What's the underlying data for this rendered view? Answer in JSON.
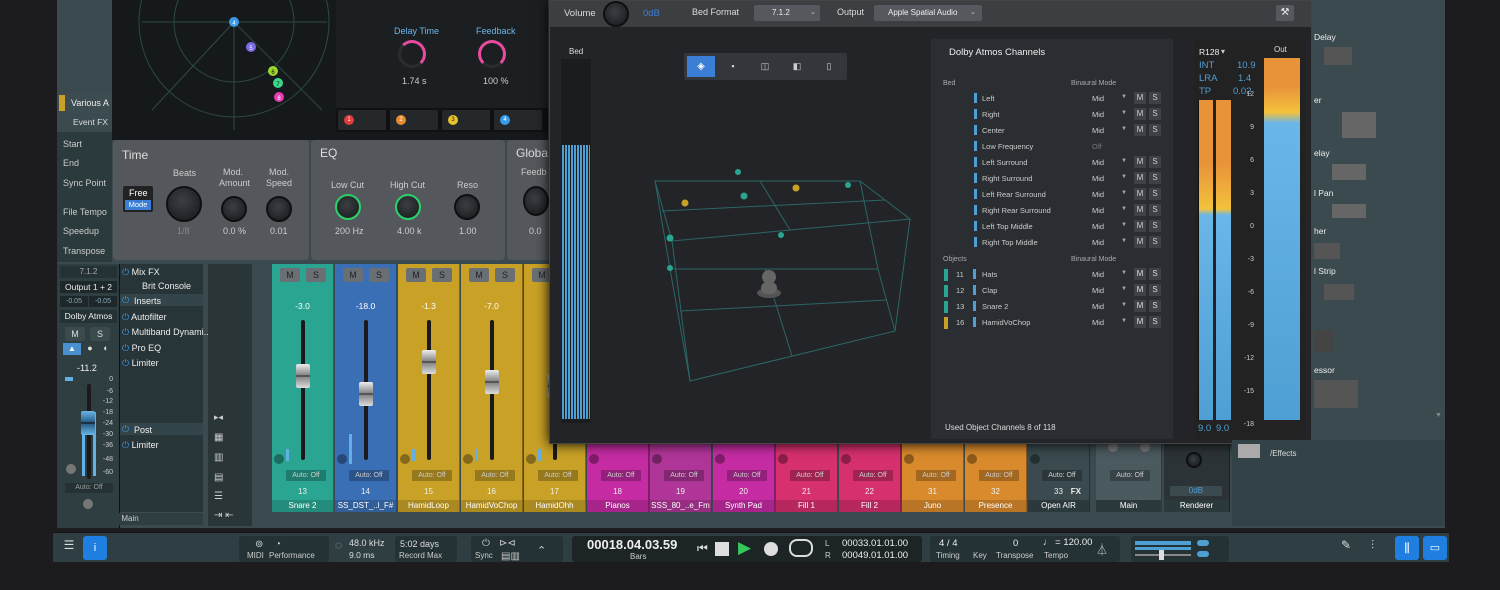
{
  "sequence": {
    "track_name": "Various A",
    "event_fx": "Event FX",
    "rows": [
      "Start",
      "End",
      "Sync Point",
      "File Tempo",
      "Speedup",
      "Transpose"
    ]
  },
  "fx": {
    "delay_time_label": "Delay Time",
    "delay_time_value": "1.74 s",
    "feedback_label": "Feedback",
    "feedback_value": "100 %",
    "slots": [
      "1",
      "2",
      "3",
      "4"
    ],
    "slot_colors": [
      "#e23b3b",
      "#e88a2e",
      "#e8c22e",
      "#3a9be8"
    ],
    "dots": [
      "4",
      "5",
      "6",
      "7",
      "8"
    ],
    "time_panel": {
      "title": "Time",
      "free": "Free",
      "mode": "Mode",
      "beats": "Beats",
      "beats_val": "1/8",
      "mod_amount": "Mod. Amount",
      "mod_amount_val": "0.0 %",
      "mod_speed": "Mod. Speed",
      "mod_speed_val": "0.01"
    },
    "eq_panel": {
      "title": "EQ",
      "low_cut": "Low Cut",
      "low_cut_val": "200 Hz",
      "high_cut": "High Cut",
      "high_cut_val": "4.00 k",
      "reso": "Reso",
      "reso_val": "1.00"
    },
    "global_panel": {
      "title": "Globa",
      "feedback": "Feedb",
      "feedback_val": "0.0"
    }
  },
  "main_channel": {
    "format": "7.1.2",
    "output": "Output 1 + 2",
    "pan_l": "-0.05",
    "pan_r": "-0.05",
    "dolby": "Dolby Atmos",
    "m": "M",
    "s": "S",
    "level": "-11.2",
    "auto": "Auto: Off",
    "name": "Main",
    "scale": [
      "0",
      "-6",
      "-12",
      "-18",
      "-24",
      "-30",
      "-36",
      "-48",
      "-60"
    ]
  },
  "inserts": {
    "mix_fx": "Mix FX",
    "console": "Brit Console",
    "inserts_label": "Inserts",
    "items": [
      "Autofilter",
      "Multiband Dynami...",
      "Pro EQ",
      "Limiter"
    ],
    "post_label": "Post",
    "post_items": [
      "Limiter"
    ]
  },
  "strips": [
    {
      "num": "13",
      "name": "Snare 2",
      "level": "-3.0",
      "color": "#2aa592",
      "auto": "Auto: Off"
    },
    {
      "num": "14",
      "name": "SS_DST_..l_F#",
      "level": "-18.0",
      "color": "#3b6fb5",
      "auto": "Auto: Off"
    },
    {
      "num": "15",
      "name": "HamidLoop",
      "level": "-1.3",
      "color": "#c9a127",
      "auto": "Auto: Off"
    },
    {
      "num": "16",
      "name": "HamidVoChop",
      "level": "-7.0",
      "color": "#c9a127",
      "auto": "Auto: Off"
    },
    {
      "num": "17",
      "name": "HamidOhh",
      "level": "",
      "color": "#c9a127",
      "auto": "Auto: Off"
    },
    {
      "num": "18",
      "name": "Pianos",
      "level": "",
      "color": "#c52ca4",
      "auto": "Auto: Off"
    },
    {
      "num": "19",
      "name": "SSS_80_..e_Fm",
      "level": "",
      "color": "#b03598",
      "auto": "Auto: Off"
    },
    {
      "num": "20",
      "name": "Synth Pad",
      "level": "",
      "color": "#c52ca4",
      "auto": "Auto: Off"
    },
    {
      "num": "21",
      "name": "Fill 1",
      "level": "",
      "color": "#d6306e",
      "auto": "Auto: Off"
    },
    {
      "num": "22",
      "name": "Fill 2",
      "level": "",
      "color": "#d6306e",
      "auto": "Auto: Off"
    },
    {
      "num": "31",
      "name": "Juno",
      "level": "",
      "color": "#d98a2c",
      "auto": "Auto: Off"
    },
    {
      "num": "32",
      "name": "Presence",
      "level": "",
      "color": "#d98a2c",
      "auto": "Auto: Off"
    },
    {
      "num": "33",
      "name": "Open AIR",
      "level": "",
      "color": "#3a4a4e",
      "auto": "Auto: Off",
      "fx": "FX"
    },
    {
      "num": "",
      "name": "Main",
      "level": "",
      "color": "#4a5a5e",
      "auto": "Auto: Off"
    },
    {
      "num": "",
      "name": "Renderer",
      "level": "0dB",
      "color": "#2c3336",
      "auto": ""
    }
  ],
  "strip_ms": {
    "m": "M",
    "s": "S"
  },
  "dolby": {
    "volume_label": "Volume",
    "volume_value": "0dB",
    "bed_format_label": "Bed Format",
    "bed_format_value": "7.1.2",
    "output_label": "Output",
    "output_value": "Apple Spatial Audio",
    "bed_label": "Bed",
    "channels_title": "Dolby Atmos Channels",
    "bed_section": "Bed",
    "binaural_mode": "Binaural Mode",
    "objects_section": "Objects",
    "bed_channels": [
      {
        "name": "Left",
        "mode": "Mid"
      },
      {
        "name": "Right",
        "mode": "Mid"
      },
      {
        "name": "Center",
        "mode": "Mid"
      },
      {
        "name": "Low Frequency",
        "mode": "Off"
      },
      {
        "name": "Left Surround",
        "mode": "Mid"
      },
      {
        "name": "Right Surround",
        "mode": "Mid"
      },
      {
        "name": "Left Rear Surround",
        "mode": "Mid"
      },
      {
        "name": "Right Rear Surround",
        "mode": "Mid"
      },
      {
        "name": "Left Top Middle",
        "mode": "Mid"
      },
      {
        "name": "Right Top Middle",
        "mode": "Mid"
      }
    ],
    "objects": [
      {
        "num": "11",
        "name": "Hats",
        "mode": "Mid",
        "color": "#2aa592"
      },
      {
        "num": "12",
        "name": "Clap",
        "mode": "Mid",
        "color": "#2aa592"
      },
      {
        "num": "13",
        "name": "Snare 2",
        "mode": "Mid",
        "color": "#2aa592"
      },
      {
        "num": "16",
        "name": "HamidVoChop",
        "mode": "Mid",
        "color": "#c9a127"
      }
    ],
    "used_objects": "Used Object Channels  8 of 118",
    "loudness": {
      "standard": "R128",
      "int_label": "INT",
      "int": "10.9",
      "lra_label": "LRA",
      "lra": "1.4",
      "tp_label": "TP",
      "tp": "0.02",
      "left": "9.0",
      "right": "9.0"
    },
    "out_label": "Out",
    "scale": [
      "12",
      "9",
      "6",
      "3",
      "0",
      "-3",
      "-6",
      "-9",
      "-12",
      "-15",
      "-18"
    ]
  },
  "browser": {
    "items": [
      "Delay",
      "er",
      "elay",
      "l Pan",
      "her",
      "l Strip",
      "essor"
    ],
    "effects": "/Effects"
  },
  "transport": {
    "midi": "MIDI",
    "performance": "Performance",
    "sample_rate": "48.0 kHz",
    "latency": "9.0 ms",
    "record_max_days": "5:02 days",
    "record_max": "Record Max",
    "sync": "Sync",
    "position": "00018.04.03.59",
    "bars": "Bars",
    "loop_l": "00033.01.01.00",
    "loop_r": "00049.01.01.00",
    "l": "L",
    "r": "R",
    "time_sig": "4 / 4",
    "timing": "Timing",
    "key": "Key",
    "transpose_val": "0",
    "transpose": "Transpose",
    "tempo_val": "120.00",
    "tempo": "Tempo"
  }
}
